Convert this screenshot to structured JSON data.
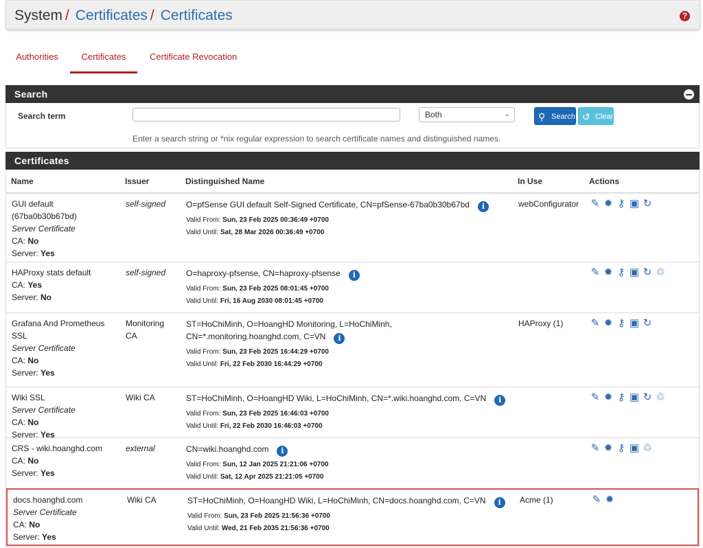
{
  "breadcrumb": {
    "root": "System",
    "sep1": "/",
    "level1": "Certificates",
    "sep2": "/",
    "level2": "Certificates"
  },
  "help_glyph": "?",
  "tabs": [
    {
      "label": "Authorities",
      "active": false
    },
    {
      "label": "Certificates",
      "active": true
    },
    {
      "label": "Certificate Revocation",
      "active": false
    }
  ],
  "search": {
    "title": "Search",
    "term_label": "Search term",
    "input_value": "",
    "select_value": "Both",
    "search_button": "Search",
    "clear_button": "Clear",
    "hint": "Enter a search string or *nix regular expression to search certificate names and distinguished names."
  },
  "certificates": {
    "title": "Certificates",
    "columns": {
      "name": "Name",
      "issuer": "Issuer",
      "dn": "Distinguished Name",
      "inuse": "In Use",
      "actions": "Actions"
    },
    "rows": [
      {
        "name_lines": [
          "GUI default",
          "(67ba0b30b67bd)"
        ],
        "type": "Server Certificate",
        "ca_label": "CA:",
        "ca": "No",
        "server_label": "Server:",
        "server": "Yes",
        "issuer": "self-signed",
        "issuer_italic": true,
        "dn_lines": [
          "O=pfSense GUI default Self-Signed Certificate, CN=pfSense-67ba0b30b67bd"
        ],
        "valid_from_label": "Valid From:",
        "valid_from": "Sun, 23 Feb 2025 00:36:49 +0700",
        "valid_until_label": "Valid Until:",
        "valid_until": "Sat, 28 Mar 2026 00:36:49 +0700",
        "in_use": "webConfigurator",
        "actions": [
          "pencil-icon",
          "gear-icon",
          "key-icon",
          "archive-icon",
          "renew-icon"
        ]
      },
      {
        "name_lines": [
          "HAProxy stats default"
        ],
        "type": "",
        "ca_label": "CA:",
        "ca": "Yes",
        "server_label": "Server:",
        "server": "No",
        "issuer": "self-signed",
        "issuer_italic": true,
        "dn_lines": [
          "O=haproxy-pfsense, CN=haproxy-pfsense"
        ],
        "valid_from_label": "Valid From:",
        "valid_from": "Sun, 23 Feb 2025 08:01:45 +0700",
        "valid_until_label": "Valid Until:",
        "valid_until": "Fri, 16 Aug 2030 08:01:45 +0700",
        "in_use": "",
        "actions": [
          "pencil-icon",
          "gear-icon",
          "key-icon",
          "archive-icon",
          "renew-icon",
          "trash-icon"
        ]
      },
      {
        "name_lines": [
          "Grafana And Prometheus",
          "SSL"
        ],
        "type": "Server Certificate",
        "ca_label": "CA:",
        "ca": "No",
        "server_label": "Server:",
        "server": "Yes",
        "issuer_lines": [
          "Monitoring",
          "CA"
        ],
        "issuer": "",
        "issuer_italic": false,
        "dn_lines": [
          "ST=HoChiMinh, O=HoangHD Monitoring, L=HoChiMinh,",
          "CN=*.monitoring.hoanghd.com, C=VN"
        ],
        "valid_from_label": "Valid From:",
        "valid_from": "Sun, 23 Feb 2025 16:44:29 +0700",
        "valid_until_label": "Valid Until:",
        "valid_until": "Fri, 22 Feb 2030 16:44:29 +0700",
        "in_use": "HAProxy (1)",
        "actions": [
          "pencil-icon",
          "gear-icon",
          "key-icon",
          "archive-icon",
          "renew-icon"
        ]
      },
      {
        "name_lines": [
          "Wiki SSL"
        ],
        "type": "Server Certificate",
        "ca_label": "CA:",
        "ca": "No",
        "server_label": "Server:",
        "server": "Yes",
        "issuer": "Wiki CA",
        "issuer_italic": false,
        "dn_lines": [
          "ST=HoChiMinh, O=HoangHD Wiki, L=HoChiMinh, CN=*.wiki.hoanghd.com, C=VN"
        ],
        "valid_from_label": "Valid From:",
        "valid_from": "Sun, 23 Feb 2025 16:46:03 +0700",
        "valid_until_label": "Valid Until:",
        "valid_until": "Fri, 22 Feb 2030 16:46:03 +0700",
        "in_use": "",
        "actions": [
          "pencil-icon",
          "gear-icon",
          "key-icon",
          "archive-icon",
          "renew-icon",
          "trash-icon"
        ]
      },
      {
        "name_lines": [
          "CRS - wiki.hoanghd.com"
        ],
        "type": "",
        "ca_label": "CA:",
        "ca": "No",
        "server_label": "Server:",
        "server": "Yes",
        "issuer": "external",
        "issuer_italic": true,
        "dn_lines": [
          "CN=wiki.hoanghd.com"
        ],
        "valid_from_label": "Valid From:",
        "valid_from": "Sun, 12 Jan 2025 21:21:06 +0700",
        "valid_until_label": "Valid Until:",
        "valid_until": "Sat, 12 Apr 2025 21:21:05 +0700",
        "in_use": "",
        "actions": [
          "pencil-icon",
          "gear-icon",
          "key-icon",
          "archive-icon",
          "trash-icon"
        ]
      },
      {
        "name_lines": [
          "docs.hoanghd.com"
        ],
        "type": "Server Certificate",
        "ca_label": "CA:",
        "ca": "No",
        "server_label": "Server:",
        "server": "Yes",
        "issuer": "Wiki CA",
        "issuer_italic": false,
        "dn_lines": [
          "ST=HoChiMinh, O=HoangHD Wiki, L=HoChiMinh, CN=docs.hoanghd.com, C=VN"
        ],
        "valid_from_label": "Valid From:",
        "valid_from": "Sun, 23 Feb 2025 21:56:36 +0700",
        "valid_until_label": "Valid Until:",
        "valid_until": "Wed, 21 Feb 2035 21:56:36 +0700",
        "in_use": "Acme (1)",
        "actions": [
          "pencil-icon",
          "gear-icon"
        ],
        "highlight": true
      }
    ]
  },
  "colors": {
    "accent": "#b21f24",
    "link": "#2a6cb0",
    "panel_header": "#333333",
    "icon": "#2d6bb2",
    "highlight": "#d9534f"
  }
}
